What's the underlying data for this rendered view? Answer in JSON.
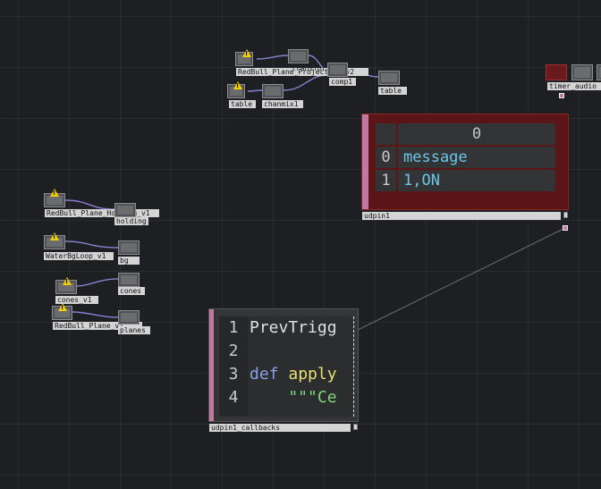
{
  "operators": {
    "top_group": [
      {
        "name": "project_label",
        "text": "RedBull_Plane_Projection_v2"
      },
      {
        "name": "table1_label",
        "text": "table"
      },
      {
        "name": "chanmix_label",
        "text": "chanmix1"
      },
      {
        "name": "transform_label",
        "text": "transform"
      },
      {
        "name": "comp_label",
        "text": "comp1"
      },
      {
        "name": "table2_label",
        "text": "table"
      }
    ],
    "left_group": [
      {
        "name": "holding_src_label",
        "text": "RedBull_Plane_Holding_v1"
      },
      {
        "name": "holding_label",
        "text": "holding"
      },
      {
        "name": "water_src_label",
        "text": "WaterBgLoop_v1"
      },
      {
        "name": "bg_label",
        "text": "bg"
      },
      {
        "name": "cones_src_label",
        "text": "cones_v1"
      },
      {
        "name": "cones_label",
        "text": "cones"
      },
      {
        "name": "planes_src_label",
        "text": "RedBull_Plane_v1"
      },
      {
        "name": "planes_label",
        "text": "planes"
      }
    ],
    "right_cluster": {
      "label": "timer_audio"
    }
  },
  "udpin": {
    "label": "udpin1",
    "header": "0",
    "rows": [
      {
        "index": "0",
        "value": "message"
      },
      {
        "index": "1",
        "value": "1,ON"
      }
    ]
  },
  "callbacks": {
    "label": "udpin1_callbacks",
    "lines": [
      {
        "num": "1",
        "kw": "",
        "fn": "PrevTrigg",
        "str": ""
      },
      {
        "num": "2",
        "kw": "",
        "fn": "",
        "str": ""
      },
      {
        "num": "3",
        "kw": "def ",
        "fn": "apply",
        "str": ""
      },
      {
        "num": "4",
        "kw": "",
        "fn": "",
        "str": "    \"\"\"Ce"
      }
    ]
  },
  "colors": {
    "background": "#1e1f22",
    "dat_table_border": "#8f2224",
    "dat_stripe": "#c07aa2",
    "wire": "#8a7fd0",
    "warning": "#f5d000"
  }
}
